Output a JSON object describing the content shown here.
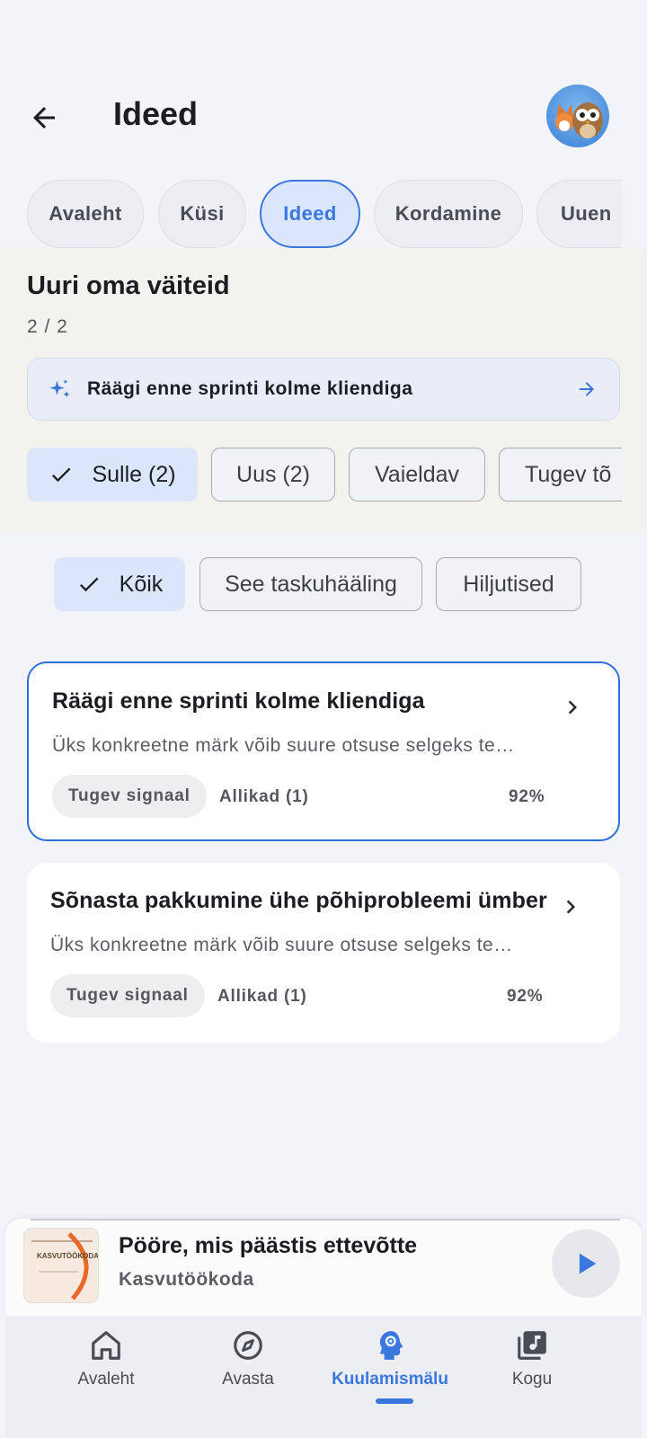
{
  "header": {
    "title": "Ideed"
  },
  "tabs": [
    {
      "label": "Avaleht"
    },
    {
      "label": "Küsi"
    },
    {
      "label": "Ideed"
    },
    {
      "label": "Kordamine"
    },
    {
      "label": "Uuen"
    }
  ],
  "panel": {
    "title": "Uuri oma väiteid",
    "count": "2 / 2",
    "suggestion": "Räägi enne sprinti kolme kliendiga",
    "filters": [
      {
        "label": "Sulle (2)"
      },
      {
        "label": "Uus (2)"
      },
      {
        "label": "Vaieldav"
      },
      {
        "label": "Tugev tõ"
      }
    ]
  },
  "scope_filters": [
    {
      "label": "Kõik"
    },
    {
      "label": "See taskuhääling"
    },
    {
      "label": "Hiljutised"
    }
  ],
  "cards": [
    {
      "title": "Räägi enne sprinti kolme kliendiga",
      "desc": "Üks konkreetne märk võib suure otsuse selgeks te…",
      "badge": "Tugev signaal",
      "sources": "Allikad (1)",
      "score": "92%"
    },
    {
      "title": "Sõnasta pakkumine ühe põhiprobleemi ümber",
      "desc": "Üks konkreetne märk võib suure otsuse selgeks te…",
      "badge": "Tugev signaal",
      "sources": "Allikad (1)",
      "score": "92%"
    }
  ],
  "player": {
    "title": "Pööre, mis päästis ettevõtte",
    "subtitle": "Kasvutöökoda",
    "cover_text": "KASVUTÖÖKODA"
  },
  "nav": [
    {
      "label": "Avaleht",
      "icon": "home-icon"
    },
    {
      "label": "Avasta",
      "icon": "compass-icon"
    },
    {
      "label": "Kuulamismälu",
      "icon": "brain-icon"
    },
    {
      "label": "Kogu",
      "icon": "library-music-icon"
    }
  ],
  "colors": {
    "accent": "#3a78e0",
    "selected_chip": "#dce6fb"
  }
}
